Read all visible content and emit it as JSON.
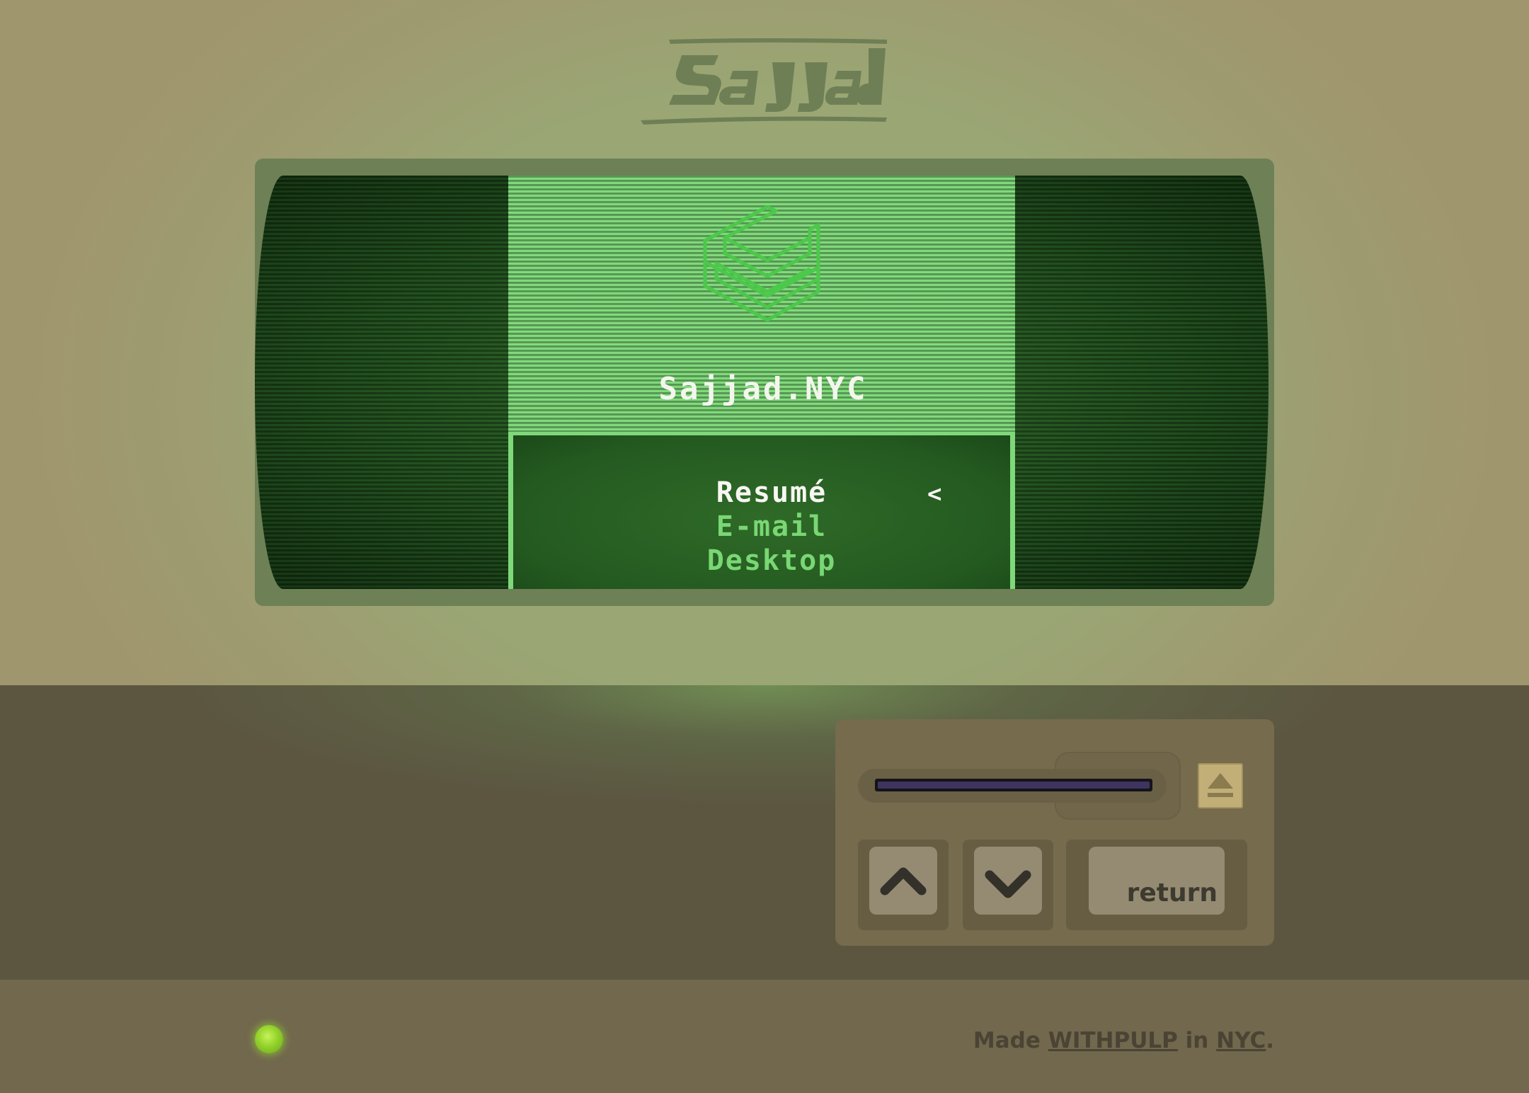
{
  "header": {
    "logo_text": "Sajjad"
  },
  "screen": {
    "site_title": "Sajjad.NYC",
    "menu": {
      "items": [
        {
          "label": "Resumé",
          "selected": true
        },
        {
          "label": "E-mail",
          "selected": false
        },
        {
          "label": "Desktop",
          "selected": false
        }
      ],
      "cursor": "<"
    }
  },
  "controls": {
    "eject_icon": "eject-icon",
    "up_icon": "chevron-up-icon",
    "down_icon": "chevron-down-icon",
    "return_label": "return"
  },
  "footer": {
    "made_text": "Made",
    "brand_link": "WITHPULP",
    "in_text": "in",
    "city_link": "NYC",
    "period": "."
  },
  "colors": {
    "screen_green": "#7fd87a",
    "crt_dark": "#1f4e1c",
    "body_top": "#99aa76",
    "body_lower": "#5c5641",
    "footer_bg": "#72684d",
    "led": "#93d22a"
  }
}
